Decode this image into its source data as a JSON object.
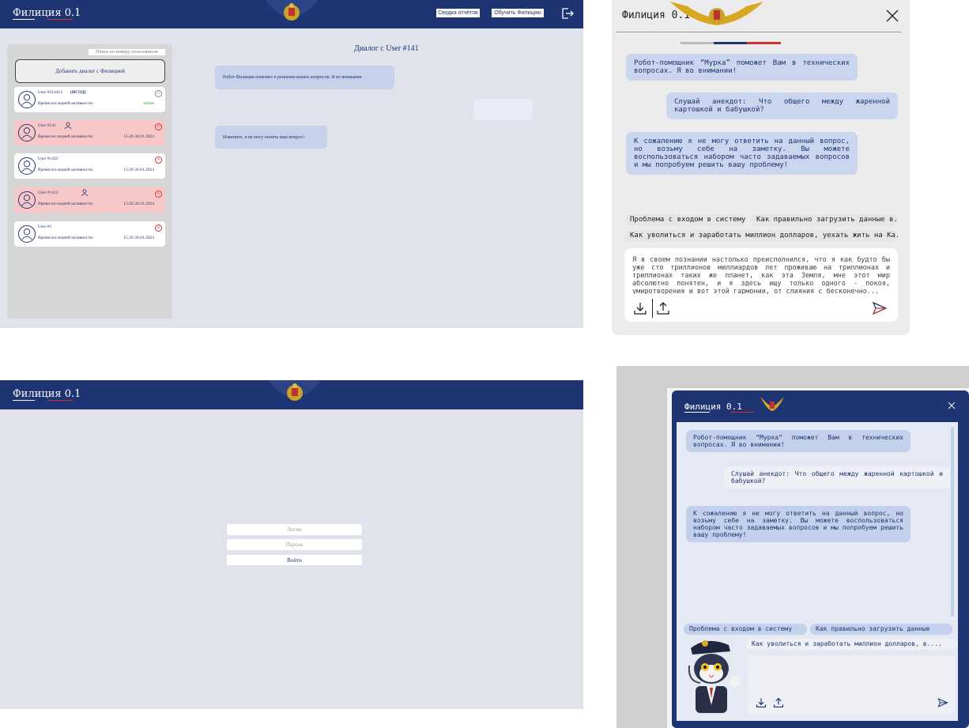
{
  "colors": {
    "header": "#1f3472",
    "alert_row": "#f8c8c8",
    "online": "#1a9e2a",
    "bubble": "#c5d2ea"
  },
  "admin": {
    "brand": "Филиция 0.1",
    "report_btn": "Сводка отчётов",
    "train_btn": "Обучить Филицию",
    "search_placeholder": "Поиск по номеру пользователя",
    "add_dialog": "Добавить диалог с Филицией",
    "activity_label": "Время последней активности:",
    "users": [
      {
        "name": "User #214412",
        "tag": "(ИСОД)",
        "time": "online",
        "alert": false,
        "operator": false
      },
      {
        "name": "User #141",
        "tag": "",
        "time": "15:26 26.01.2024",
        "alert": true,
        "operator": true
      },
      {
        "name": "User #1412",
        "tag": "",
        "time": "15:26 26.01.2024",
        "alert": false,
        "operator": false
      },
      {
        "name": "User #1412",
        "tag": "",
        "time": "15:26 26.01.2024",
        "alert": true,
        "operator": true
      },
      {
        "name": "User #1",
        "tag": "",
        "time": "15:26 26.01.2024",
        "alert": false,
        "operator": false
      }
    ],
    "dialog_title": "Диалог с User #141",
    "bot_msg1": "Робот Филиция поможет в решении ваших вопросов. Я во внимании",
    "bot_msg2": "Извините, я не могу понять ваш вопрос!"
  },
  "widget": {
    "brand": "Филиция 0.1",
    "bot_msg1": "Робот-помощник “Мурка” поможет Вам в технических вопросах. Я во внимании!",
    "user_msg": "Слушай анекдот: Что общего между жаренной картошкой и бабушкой?",
    "bot_msg2": "К сожалению я не могу ответить на данный вопрос, но возьму себе на заметку. Вы можете воспользоваться набором часто задаваемых вопросов и мы попробуем решить вашу проблему!",
    "chip1": "Проблема с входом в систему",
    "chip2": "Как правильно загрузить данные в...",
    "chip3": "Как уволиться и заработать миллион долларов, уехать жить на Ка...",
    "input_text": "Я в своем познании настолько преисполнился, что я как будто бы уже сто триллионов миллиардов лет проживаю на триллионах и триллионах таких же планет, как эта Земля, мне этот мир абсолютно понятен, и я здесь ищу только одного - покоя, умиротворения и вот этой гармонии, от слияния с бесконечно..."
  },
  "login": {
    "brand": "Филиция 0.1",
    "login_placeholder": "Логин",
    "password_placeholder": "Пароль",
    "submit": "Войти"
  },
  "mascot": {
    "brand": "Филиция 0.1",
    "bot_msg1": "Робот-помощник “Мурка” поможет Вам в технических вопросах. Я во внимании!",
    "user_msg": "Слушай анекдот: Что общего между жаренной картошкой и бабушкой?",
    "bot_msg2": "К сожалению я не могу ответить на данный вопрос, но возьму себе на заметку. Вы можете воспользоваться набором часто задаваемых вопросов и мы попробуем решить вашу проблему!",
    "chip1": "Проблема с входом в систему",
    "chip2": "Как правильно загрузить данные",
    "chip3": "Как уволиться и заработать миллион долларов, в...."
  }
}
